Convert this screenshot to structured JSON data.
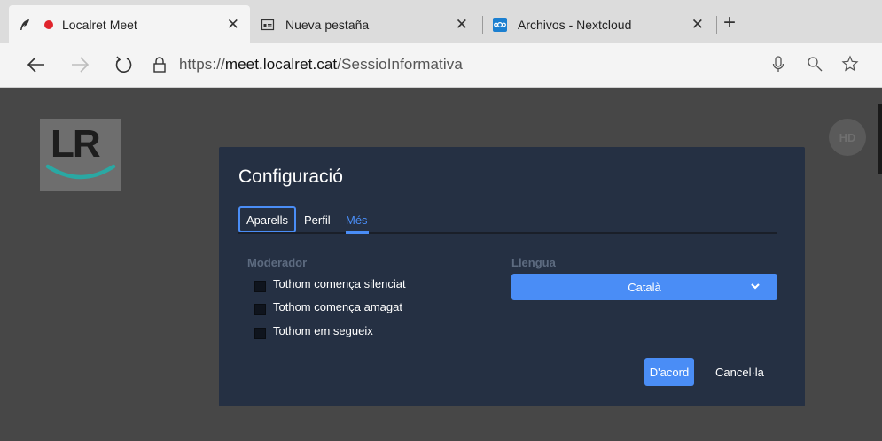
{
  "browser": {
    "tabs": [
      {
        "title": "Localret Meet",
        "icon": "feather-icon",
        "recording": true,
        "active": true
      },
      {
        "title": "Nueva pestaña",
        "icon": "newtab-icon",
        "active": false
      },
      {
        "title": "Archivos - Nextcloud",
        "icon": "nextcloud-icon",
        "active": false
      }
    ],
    "close_glyph": "✕",
    "new_tab_glyph": "+",
    "url_scheme": "https://",
    "url_host": "meet.localret.cat",
    "url_path": "/SessioInformativa"
  },
  "page": {
    "logo_text": "LR",
    "avatar_initials": "HD"
  },
  "dialog": {
    "title": "Configuració",
    "tabs": [
      {
        "label": "Aparells",
        "state": "focused"
      },
      {
        "label": "Perfil",
        "state": "normal"
      },
      {
        "label": "Més",
        "state": "selected"
      }
    ],
    "moderator": {
      "label": "Moderador",
      "options": [
        {
          "label": "Tothom comença silenciat",
          "checked": false
        },
        {
          "label": "Tothom comença amagat",
          "checked": false
        },
        {
          "label": "Tothom em segueix",
          "checked": false
        }
      ]
    },
    "language": {
      "label": "Llengua",
      "selected": "Català"
    },
    "ok_label": "D'acord",
    "cancel_label": "Cancel·la"
  },
  "colors": {
    "accent": "#4a8df6",
    "dialog_bg": "#253043",
    "page_bg": "#474747",
    "recording_dot": "#e0242c"
  }
}
